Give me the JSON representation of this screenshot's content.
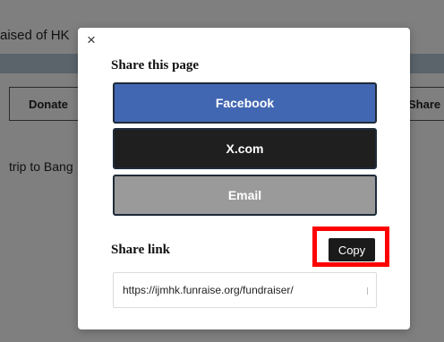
{
  "background": {
    "raised_text": "aised of HK",
    "donate_label": "Donate",
    "share_label": "Share",
    "trip_text": "trip to Bang"
  },
  "modal": {
    "close_glyph": "×",
    "title": "Share this page",
    "buttons": {
      "facebook": "Facebook",
      "xcom": "X.com",
      "email": "Email"
    },
    "link_label": "Share link",
    "copy_label": "Copy",
    "link_value": "https://ijmhk.funraise.org/fundraiser/"
  },
  "colors": {
    "facebook": "#4267b2",
    "xcom": "#1f1f1f",
    "email": "#9a9a9a",
    "highlight": "#ff0000"
  }
}
